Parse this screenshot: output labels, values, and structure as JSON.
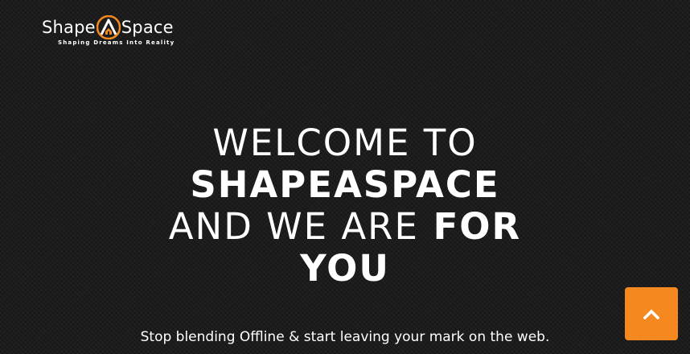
{
  "logo": {
    "name_left": "Shape",
    "name_right": "Space",
    "mark": "A",
    "tagline": "Shaping Dreams Into Reality",
    "accent_color": "#f5891f"
  },
  "hero": {
    "line1": "WELCOME TO",
    "line2": "SHAPEASPACE",
    "line3_light": "AND WE ARE",
    "line3_bold": "FOR",
    "line4": "YOU",
    "subtitle": "Stop blending Offline & start leaving your mark on the web."
  },
  "back_to_top": {
    "icon": "chevron-up-icon",
    "color": "#f5891f"
  }
}
